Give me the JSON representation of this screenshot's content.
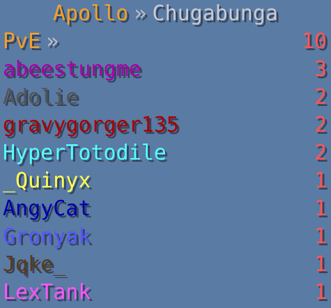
{
  "header": {
    "left": "Apollo",
    "separator": "»",
    "right": "Chugabunga",
    "left_color": "#f3a12a",
    "separator_color": "#b8c0cc",
    "right_color": "#c7ccd6"
  },
  "objective": {
    "label": "PvE",
    "separator": "»",
    "label_color": "#f3a12a",
    "separator_color": "#b8c0cc"
  },
  "score_color": "#ff5555",
  "scoreboard_bg": "#5a7ba3",
  "rows": [
    {
      "name": "abeestungme",
      "score": "3",
      "color": "#aa00aa"
    },
    {
      "name": "Adolie",
      "score": "2",
      "color": "#555555"
    },
    {
      "name": "gravygorger135",
      "score": "2",
      "color": "#aa0000"
    },
    {
      "name": "HyperTotodile",
      "score": "2",
      "color": "#55ffff"
    },
    {
      "name": "_Quinyx",
      "score": "1",
      "color": "#ffff55"
    },
    {
      "name": "AngyCat",
      "score": "1",
      "color": "#0000aa"
    },
    {
      "name": "Gronyak",
      "score": "1",
      "color": "#5555ff"
    },
    {
      "name": "Jqke_",
      "score": "1",
      "color": "#5b3a17"
    },
    {
      "name": "LexTank",
      "score": "1",
      "color": "#ff55ff"
    }
  ],
  "objective_score": "10"
}
